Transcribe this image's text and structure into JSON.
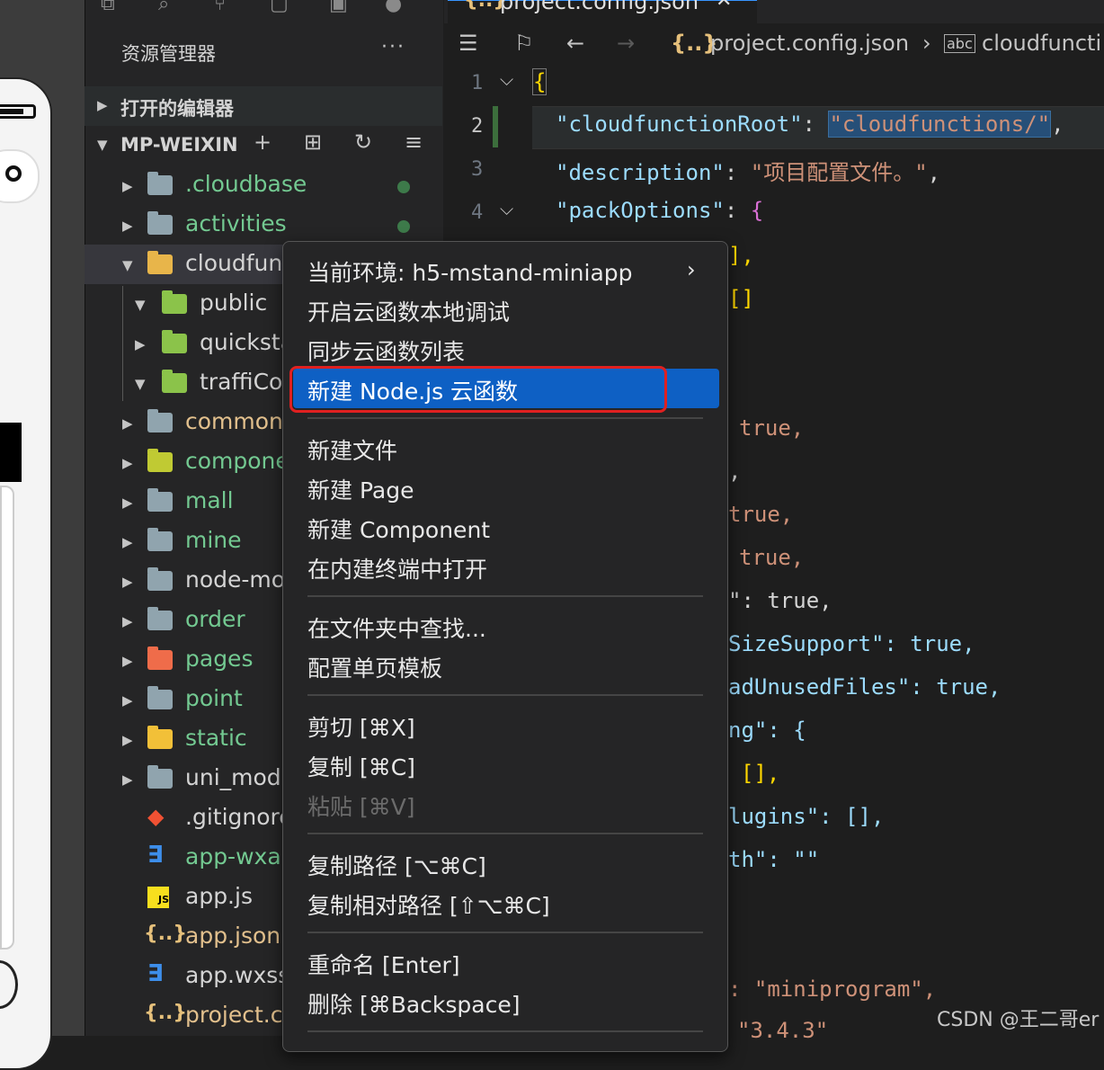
{
  "tab": {
    "title": "project.config.json"
  },
  "breadcrumb": {
    "file": "project.config.json",
    "key": "cloudfuncti"
  },
  "explorer": {
    "title": "资源管理器",
    "more": "···",
    "open_editors": "打开的编辑器",
    "root": "MP-WEIXIN"
  },
  "tree": [
    {
      "label": ".cloudbase",
      "color": "#73c991"
    },
    {
      "label": "activities",
      "color": "#73c991"
    },
    {
      "label": "cloudfun",
      "color": "#d4d4d4"
    },
    {
      "label": "public",
      "color": "#d4d4d4"
    },
    {
      "label": "quicksta",
      "color": "#d4d4d4"
    },
    {
      "label": "traffiCo",
      "color": "#d4d4d4"
    },
    {
      "label": "common",
      "color": "#e2c08d"
    },
    {
      "label": "compone",
      "color": "#73c991"
    },
    {
      "label": "mall",
      "color": "#73c991"
    },
    {
      "label": "mine",
      "color": "#73c991"
    },
    {
      "label": "node-mo",
      "color": "#d4d4d4"
    },
    {
      "label": "order",
      "color": "#73c991"
    },
    {
      "label": "pages",
      "color": "#73c991"
    },
    {
      "label": "point",
      "color": "#73c991"
    },
    {
      "label": "static",
      "color": "#73c991"
    },
    {
      "label": "uni_mod",
      "color": "#d4d4d4"
    },
    {
      "label": ".gitignore",
      "color": "#d4d4d4"
    },
    {
      "label": "app-wxa",
      "color": "#73c991"
    },
    {
      "label": "app.js",
      "color": "#d4d4d4"
    },
    {
      "label": "app.json",
      "color": "#e2c08d"
    },
    {
      "label": "app.wxss",
      "color": "#d4d4d4"
    },
    {
      "label": "project.c",
      "color": "#e2c08d"
    }
  ],
  "editor": {
    "line_numbers": [
      "1",
      "2",
      "3",
      "4"
    ],
    "line1": "{",
    "line2_key": "\"cloudfunctionRoot\"",
    "line2_colon": ": ",
    "line2_value": "\"cloudfunctions/\"",
    "line2_comma": ",",
    "line3_key": "\"description\"",
    "line3_colon": ": ",
    "line3_value": "\"项目配置文件。\"",
    "line3_comma": ",",
    "line4_key": "\"packOptions\"",
    "line4_colon": ": ",
    "line4_brace": "{",
    "frag": [
      "],",
      "[]",
      "true,",
      ",",
      "true,",
      "true,",
      "\": true,",
      "SizeSupport\": true,",
      "adUnusedFiles\": true,",
      "ng\": {",
      "[],",
      "lugins\": [],",
      "th\": \"\"",
      ": \"miniprogram\",",
      "\"3.4.3\""
    ]
  },
  "menu": {
    "env": "当前环境: h5-mstand-miniapp",
    "debug": "开启云函数本地调试",
    "sync": "同步云函数列表",
    "new_node": "新建 Node.js 云函数",
    "new_file": "新建文件",
    "new_page": "新建 Page",
    "new_component": "新建 Component",
    "open_terminal": "在内建终端中打开",
    "find_in_folder": "在文件夹中查找...",
    "page_template": "配置单页模板",
    "cut": "剪切 [⌘X]",
    "copy": "复制 [⌘C]",
    "paste": "粘贴 [⌘V]",
    "copy_path": "复制路径 [⌥⌘C]",
    "copy_rel_path": "复制相对路径 [⇧⌥⌘C]",
    "rename": "重命名 [Enter]",
    "delete": "删除 [⌘Backspace]"
  },
  "watermark": "CSDN @王二哥er"
}
